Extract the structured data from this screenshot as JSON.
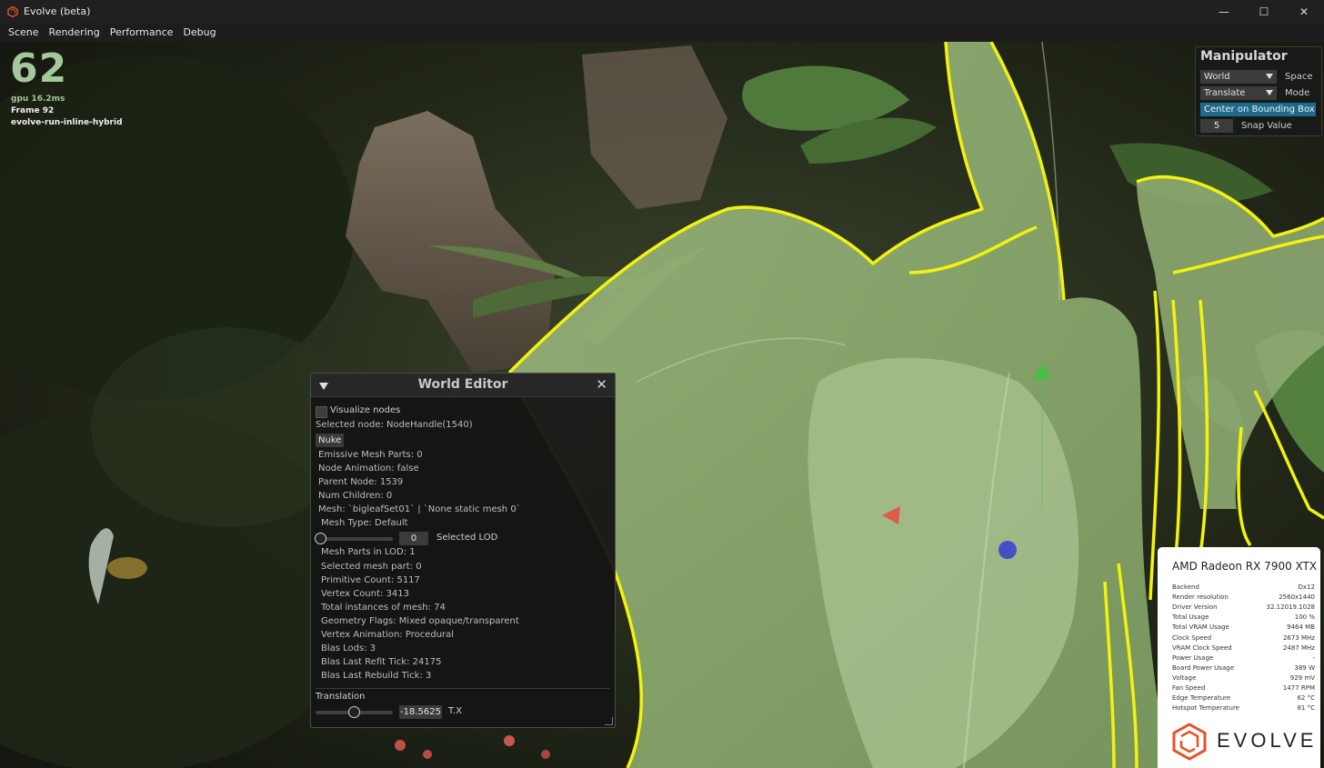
{
  "window": {
    "title": "Evolve (beta)",
    "controls": [
      "—",
      "☐",
      "✕"
    ]
  },
  "menu": {
    "items": [
      "Scene",
      "Rendering",
      "Performance",
      "Debug"
    ]
  },
  "stats": {
    "fps": "62",
    "gpu_time": "gpu 16.2ms",
    "frame": "Frame 92",
    "run_name": "evolve-run-inline-hybrid"
  },
  "manipulator": {
    "title": "Manipulator",
    "space_value": "World",
    "space_label": "Space",
    "mode_value": "Translate",
    "mode_label": "Mode",
    "center_button": "Center on Bounding Box",
    "snap_value": "5",
    "snap_label": "Snap Value"
  },
  "world_editor": {
    "title": "World Editor",
    "close": "✕",
    "visualize_nodes": "Visualize nodes",
    "selected_node": "Selected node: NodeHandle(1540)",
    "nuke_button": "Nuke",
    "props": [
      "Emissive Mesh Parts: 0",
      "Node Animation: false",
      "Parent Node: 1539",
      "Num Children: 0",
      "Mesh: `bigleafSet01` | `None static mesh 0`",
      "Mesh Type: Default"
    ],
    "lod_value": "0",
    "lod_label": "Selected LOD",
    "lod_details": [
      "Mesh Parts in LOD: 1",
      "Selected mesh part: 0",
      "Primitive Count: 5117",
      "Vertex Count: 3413",
      "Total instances of mesh: 74",
      "Geometry Flags: Mixed opaque/transparent",
      "Vertex Animation: Procedural",
      "Blas Lods: 3",
      "Blas Last Refit Tick: 24175",
      "Blas Last Rebuild Tick: 3"
    ],
    "translation_heading": "Translation",
    "tx_value": "-18.5625",
    "tx_label": "T.X"
  },
  "gpu_panel": {
    "name": "AMD Radeon RX 7900 XTX",
    "rows": [
      {
        "k": "Backend",
        "v": "Dx12"
      },
      {
        "k": "Render resolution",
        "v": "2560x1440"
      },
      {
        "k": "Driver Version",
        "v": "32.12019.1028"
      },
      {
        "k": "Total Usage",
        "v": "100 %"
      },
      {
        "k": "Total VRAM Usage",
        "v": "9464 MB"
      },
      {
        "k": "Clock Speed",
        "v": "2673 MHz"
      },
      {
        "k": "VRAM Clock Speed",
        "v": "2487 MHz"
      },
      {
        "k": "Power Usage",
        "v": "-"
      },
      {
        "k": "Board Power Usage",
        "v": "389 W"
      },
      {
        "k": "Voltage",
        "v": "929 mV"
      },
      {
        "k": "Fan Speed",
        "v": "1477 RPM"
      },
      {
        "k": "Edge Temperature",
        "v": "62 °C"
      },
      {
        "k": "Hotspot Temperature",
        "v": "81 °C"
      }
    ],
    "logo_text": "EVOLVE"
  },
  "colors": {
    "accent_blue": "#1d6a8e",
    "selection_outline": "#f2f20e",
    "fps_green": "#a4c79b",
    "leaf_tint": "#8fae6e"
  }
}
